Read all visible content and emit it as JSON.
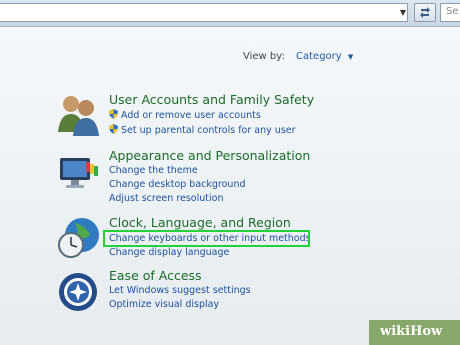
{
  "toolbar": {
    "search_placeholder": "Se",
    "icons": [
      "chevron-down-icon",
      "refresh-icon"
    ]
  },
  "view_by": {
    "label": "View by:",
    "value": "Category"
  },
  "categories": [
    {
      "title": "User Accounts and Family Safety",
      "icon": "users-icon",
      "links": [
        {
          "text": "Add or remove user accounts",
          "shield": true
        },
        {
          "text": "Set up parental controls for any user",
          "shield": true
        }
      ]
    },
    {
      "title": "Appearance and Personalization",
      "icon": "monitor-paint-icon",
      "links": [
        {
          "text": "Change the theme",
          "shield": false
        },
        {
          "text": "Change desktop background",
          "shield": false
        },
        {
          "text": "Adjust screen resolution",
          "shield": false
        }
      ]
    },
    {
      "title": "Clock, Language, and Region",
      "icon": "globe-clock-icon",
      "links": [
        {
          "text": "Change keyboards or other input methods",
          "shield": false
        },
        {
          "text": "Change display language",
          "shield": false
        }
      ]
    },
    {
      "title": "Ease of Access",
      "icon": "ease-of-access-icon",
      "links": [
        {
          "text": "Let Windows suggest settings",
          "shield": false
        },
        {
          "text": "Optimize visual display",
          "shield": false
        }
      ]
    }
  ],
  "highlight_color": "#23d23a",
  "watermark": "wikiHow"
}
